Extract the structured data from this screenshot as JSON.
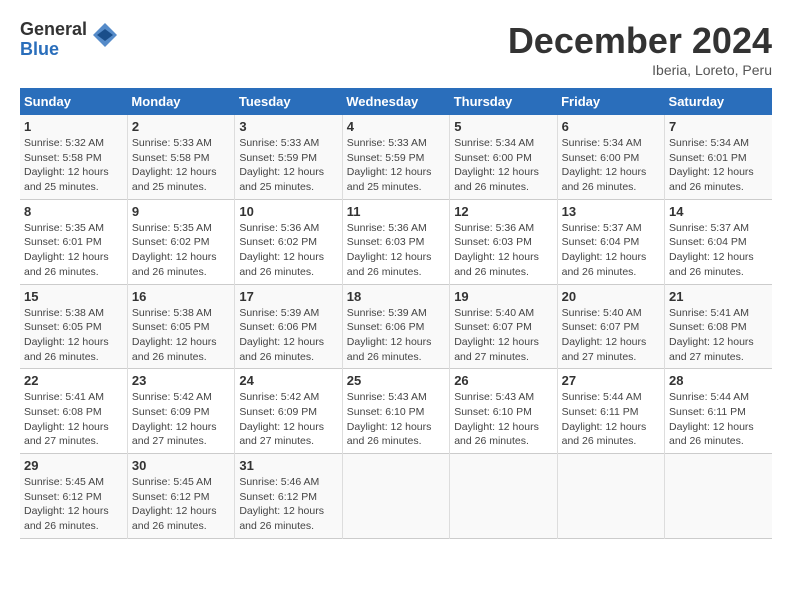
{
  "logo": {
    "general": "General",
    "blue": "Blue"
  },
  "title": "December 2024",
  "location": "Iberia, Loreto, Peru",
  "days_of_week": [
    "Sunday",
    "Monday",
    "Tuesday",
    "Wednesday",
    "Thursday",
    "Friday",
    "Saturday"
  ],
  "weeks": [
    [
      {
        "day": "1",
        "info": "Sunrise: 5:32 AM\nSunset: 5:58 PM\nDaylight: 12 hours\nand 25 minutes."
      },
      {
        "day": "2",
        "info": "Sunrise: 5:33 AM\nSunset: 5:58 PM\nDaylight: 12 hours\nand 25 minutes."
      },
      {
        "day": "3",
        "info": "Sunrise: 5:33 AM\nSunset: 5:59 PM\nDaylight: 12 hours\nand 25 minutes."
      },
      {
        "day": "4",
        "info": "Sunrise: 5:33 AM\nSunset: 5:59 PM\nDaylight: 12 hours\nand 25 minutes."
      },
      {
        "day": "5",
        "info": "Sunrise: 5:34 AM\nSunset: 6:00 PM\nDaylight: 12 hours\nand 26 minutes."
      },
      {
        "day": "6",
        "info": "Sunrise: 5:34 AM\nSunset: 6:00 PM\nDaylight: 12 hours\nand 26 minutes."
      },
      {
        "day": "7",
        "info": "Sunrise: 5:34 AM\nSunset: 6:01 PM\nDaylight: 12 hours\nand 26 minutes."
      }
    ],
    [
      {
        "day": "8",
        "info": "Sunrise: 5:35 AM\nSunset: 6:01 PM\nDaylight: 12 hours\nand 26 minutes."
      },
      {
        "day": "9",
        "info": "Sunrise: 5:35 AM\nSunset: 6:02 PM\nDaylight: 12 hours\nand 26 minutes."
      },
      {
        "day": "10",
        "info": "Sunrise: 5:36 AM\nSunset: 6:02 PM\nDaylight: 12 hours\nand 26 minutes."
      },
      {
        "day": "11",
        "info": "Sunrise: 5:36 AM\nSunset: 6:03 PM\nDaylight: 12 hours\nand 26 minutes."
      },
      {
        "day": "12",
        "info": "Sunrise: 5:36 AM\nSunset: 6:03 PM\nDaylight: 12 hours\nand 26 minutes."
      },
      {
        "day": "13",
        "info": "Sunrise: 5:37 AM\nSunset: 6:04 PM\nDaylight: 12 hours\nand 26 minutes."
      },
      {
        "day": "14",
        "info": "Sunrise: 5:37 AM\nSunset: 6:04 PM\nDaylight: 12 hours\nand 26 minutes."
      }
    ],
    [
      {
        "day": "15",
        "info": "Sunrise: 5:38 AM\nSunset: 6:05 PM\nDaylight: 12 hours\nand 26 minutes."
      },
      {
        "day": "16",
        "info": "Sunrise: 5:38 AM\nSunset: 6:05 PM\nDaylight: 12 hours\nand 26 minutes."
      },
      {
        "day": "17",
        "info": "Sunrise: 5:39 AM\nSunset: 6:06 PM\nDaylight: 12 hours\nand 26 minutes."
      },
      {
        "day": "18",
        "info": "Sunrise: 5:39 AM\nSunset: 6:06 PM\nDaylight: 12 hours\nand 26 minutes."
      },
      {
        "day": "19",
        "info": "Sunrise: 5:40 AM\nSunset: 6:07 PM\nDaylight: 12 hours\nand 27 minutes."
      },
      {
        "day": "20",
        "info": "Sunrise: 5:40 AM\nSunset: 6:07 PM\nDaylight: 12 hours\nand 27 minutes."
      },
      {
        "day": "21",
        "info": "Sunrise: 5:41 AM\nSunset: 6:08 PM\nDaylight: 12 hours\nand 27 minutes."
      }
    ],
    [
      {
        "day": "22",
        "info": "Sunrise: 5:41 AM\nSunset: 6:08 PM\nDaylight: 12 hours\nand 27 minutes."
      },
      {
        "day": "23",
        "info": "Sunrise: 5:42 AM\nSunset: 6:09 PM\nDaylight: 12 hours\nand 27 minutes."
      },
      {
        "day": "24",
        "info": "Sunrise: 5:42 AM\nSunset: 6:09 PM\nDaylight: 12 hours\nand 27 minutes."
      },
      {
        "day": "25",
        "info": "Sunrise: 5:43 AM\nSunset: 6:10 PM\nDaylight: 12 hours\nand 26 minutes."
      },
      {
        "day": "26",
        "info": "Sunrise: 5:43 AM\nSunset: 6:10 PM\nDaylight: 12 hours\nand 26 minutes."
      },
      {
        "day": "27",
        "info": "Sunrise: 5:44 AM\nSunset: 6:11 PM\nDaylight: 12 hours\nand 26 minutes."
      },
      {
        "day": "28",
        "info": "Sunrise: 5:44 AM\nSunset: 6:11 PM\nDaylight: 12 hours\nand 26 minutes."
      }
    ],
    [
      {
        "day": "29",
        "info": "Sunrise: 5:45 AM\nSunset: 6:12 PM\nDaylight: 12 hours\nand 26 minutes."
      },
      {
        "day": "30",
        "info": "Sunrise: 5:45 AM\nSunset: 6:12 PM\nDaylight: 12 hours\nand 26 minutes."
      },
      {
        "day": "31",
        "info": "Sunrise: 5:46 AM\nSunset: 6:12 PM\nDaylight: 12 hours\nand 26 minutes."
      },
      {
        "day": "",
        "info": ""
      },
      {
        "day": "",
        "info": ""
      },
      {
        "day": "",
        "info": ""
      },
      {
        "day": "",
        "info": ""
      }
    ]
  ]
}
